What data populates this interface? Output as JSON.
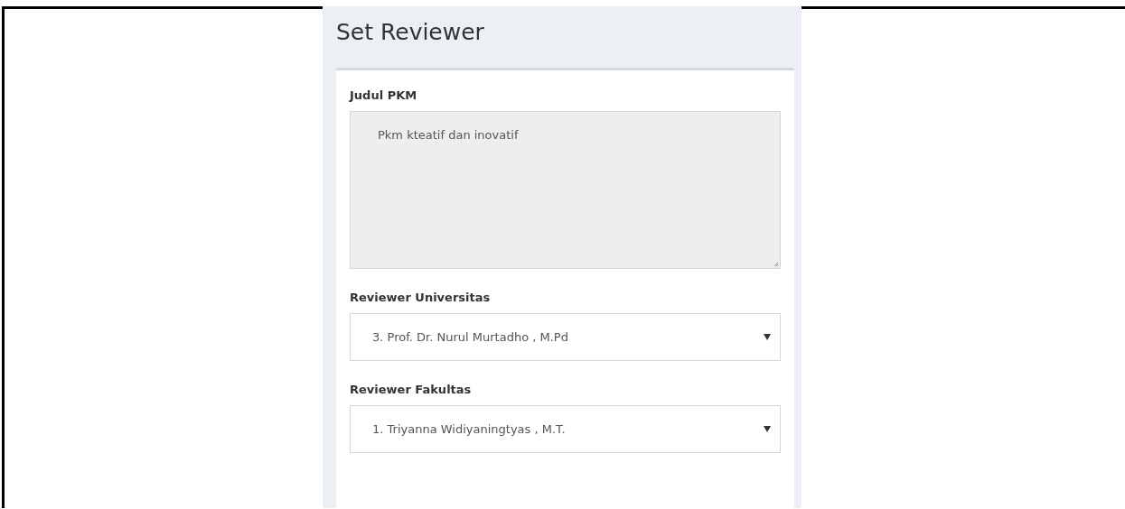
{
  "page": {
    "title": "Set Reviewer"
  },
  "form": {
    "fields": [
      {
        "kind": "textarea",
        "label": "Judul PKM",
        "value": "Pkm kteatif dan inovatif",
        "disabled": true
      },
      {
        "kind": "select",
        "label": "Reviewer Universitas",
        "value": "3. Prof. Dr. Nurul Murtadho , M.Pd",
        "disabled": false
      },
      {
        "kind": "select",
        "label": "Reviewer Fakultas",
        "value": "1. Triyanna Widiyaningtyas , M.T.",
        "disabled": false
      }
    ]
  }
}
